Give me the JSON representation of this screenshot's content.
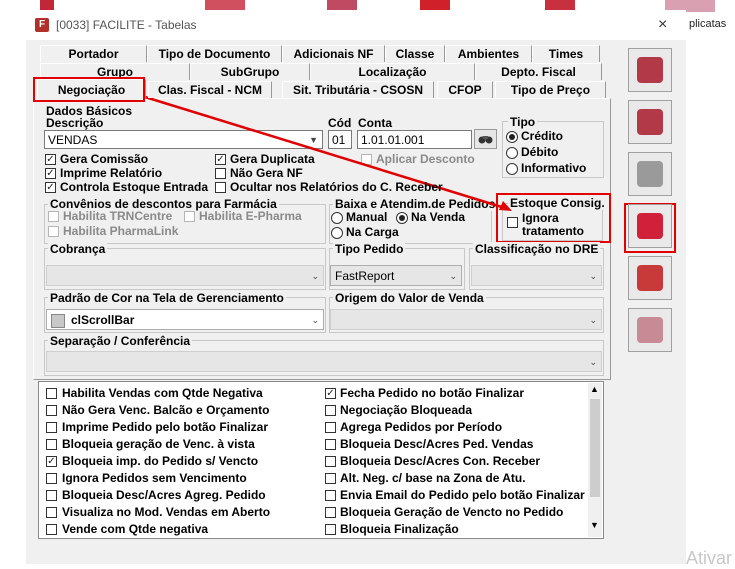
{
  "window": {
    "app_icon": "F",
    "title": "[0033] FACILITE - Tabelas",
    "close": "×"
  },
  "background": {
    "right_label": "plicatas",
    "watermark": "Ativar"
  },
  "tabs_row1": [
    "Portador",
    "Tipo de Documento",
    "Adicionais NF",
    "Classe",
    "Ambientes",
    "Times"
  ],
  "tabs_row2": [
    "Grupo",
    "SubGrupo",
    "Localização",
    "Depto. Fiscal"
  ],
  "tabs_row3": [
    "Negociação",
    "Clas. Fiscal - NCM",
    "Sit. Tributária - CSOSN",
    "CFOP",
    "Tipo de Preço"
  ],
  "dados": {
    "title": "Dados Básicos",
    "descricao_label": "Descrição",
    "descricao_value": "VENDAS",
    "cod_label": "Cód",
    "cod_value": "01",
    "conta_label": "Conta",
    "conta_value": "1.01.01.001"
  },
  "tipo": {
    "title": "Tipo",
    "options": [
      "Crédito",
      "Débito",
      "Informativo"
    ],
    "selected": "Crédito"
  },
  "checks_left": [
    {
      "label": "Gera Comissão",
      "checked": true
    },
    {
      "label": "Imprime Relatório",
      "checked": true
    },
    {
      "label": "Controla Estoque Entrada",
      "checked": true
    }
  ],
  "checks_mid": [
    {
      "label": "Gera Duplicata",
      "checked": true
    },
    {
      "label": "Não Gera NF",
      "checked": false
    },
    {
      "label": "Ocultar nos Relatórios do C. Receber",
      "checked": false
    }
  ],
  "aplicar_desconto": "Aplicar Desconto",
  "convenios": {
    "title": "Convênios de descontos para Farmácia",
    "items": [
      "Habilita TRNCentre",
      "Habilita E-Pharma",
      "Habilita PharmaLink"
    ]
  },
  "baixa": {
    "title": "Baixa e Atendim.de Pedidos",
    "options": [
      "Manual",
      "Na Venda",
      "Na Carga"
    ],
    "selected": "Na Venda"
  },
  "estoque": {
    "title": "Estoque Consig.",
    "label": "Ignora tratamento",
    "line1": "Ignora",
    "line2": "tratamento"
  },
  "cobranca_label": "Cobrança",
  "tipo_pedido": {
    "label": "Tipo Pedido",
    "value": "FastReport"
  },
  "classificacao_label": "Classificação no DRE",
  "padrao_cor": {
    "label": "Padrão de Cor na Tela de Gerenciamento",
    "value": "clScrollBar"
  },
  "origem_label": "Origem do Valor de Venda",
  "separacao_label": "Separação / Conferência",
  "list_left": [
    {
      "label": "Habilita Vendas com Qtde Negativa",
      "checked": false
    },
    {
      "label": "Não Gera Venc. Balcão e Orçamento",
      "checked": false
    },
    {
      "label": "Imprime Pedido pelo botão Finalizar",
      "checked": false
    },
    {
      "label": "Bloqueia geração de Venc. à vista",
      "checked": false
    },
    {
      "label": "Bloqueia imp. do Pedido s/ Vencto",
      "checked": true
    },
    {
      "label": "Ignora Pedidos sem Vencimento",
      "checked": false
    },
    {
      "label": "Bloqueia Desc/Acres Agreg. Pedido",
      "checked": false
    },
    {
      "label": "Visualiza no Mod. Vendas em Aberto",
      "checked": false
    },
    {
      "label": "Vende com Qtde negativa",
      "checked": false
    }
  ],
  "list_right": [
    {
      "label": "Fecha Pedido no botão Finalizar",
      "checked": true
    },
    {
      "label": "Negociação Bloqueada",
      "checked": false
    },
    {
      "label": "Agrega Pedidos por Período",
      "checked": false
    },
    {
      "label": "Bloqueia Desc/Acres Ped. Vendas",
      "checked": false
    },
    {
      "label": "Bloqueia Desc/Acres Con. Receber",
      "checked": false
    },
    {
      "label": "Alt. Neg. c/ base na Zona de Atu.",
      "checked": false
    },
    {
      "label": "Envia Email do Pedido pelo botão Finalizar",
      "checked": false
    },
    {
      "label": "Bloqueia Geração de Vencto no Pedido",
      "checked": false
    },
    {
      "label": "Bloqueia Finalização",
      "checked": false
    }
  ],
  "toolbar": [
    "save-icon",
    "trash-icon",
    "printer-icon",
    "exit-door-icon",
    "lifebuoy-icon",
    "gears-icon"
  ],
  "colors": {
    "highlight": "#e00000",
    "panel": "#f0f0f0"
  }
}
